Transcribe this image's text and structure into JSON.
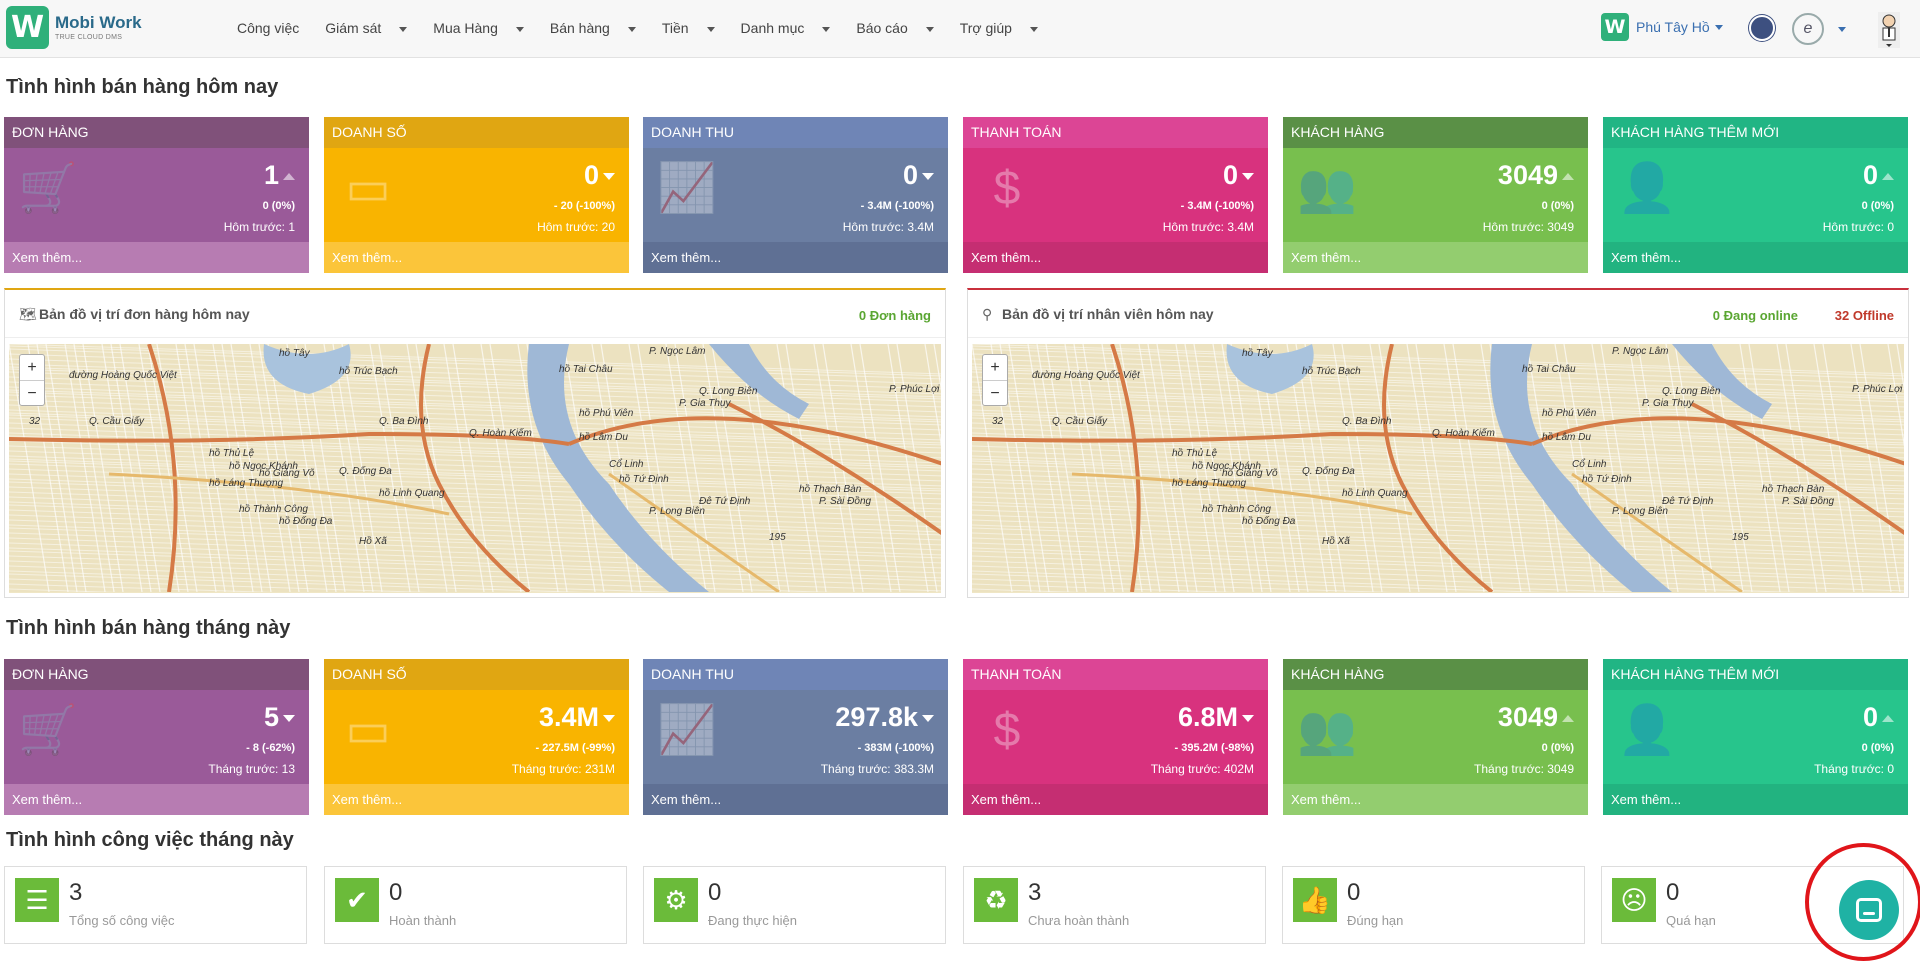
{
  "app": {
    "logo_mark": "W",
    "logo_name": "Mobi Work",
    "logo_tag": "TRUE CLOUD DMS"
  },
  "menu": [
    {
      "label": "Công việc",
      "dropdown": false
    },
    {
      "label": "Giám sát",
      "dropdown": true
    },
    {
      "label": "Mua Hàng",
      "dropdown": true
    },
    {
      "label": "Bán hàng",
      "dropdown": true
    },
    {
      "label": "Tiền",
      "dropdown": true
    },
    {
      "label": "Danh mục",
      "dropdown": true
    },
    {
      "label": "Báo cáo",
      "dropdown": true
    },
    {
      "label": "Trợ giúp",
      "dropdown": true
    }
  ],
  "header": {
    "branch": "Phú Tây Hồ",
    "branch_mark": "W"
  },
  "today": {
    "title": "Tình hình bán hàng hôm nay",
    "cards": [
      {
        "title": "ĐƠN HÀNG",
        "value": "1",
        "change": "0 (0%)",
        "prev": "Hôm trước: 1",
        "more": "Xem thêm...",
        "icon": "cart-icon",
        "glyph": "🛒",
        "trend": "up"
      },
      {
        "title": "DOANH SỐ",
        "value": "0",
        "change": "- 20 (-100%)",
        "prev": "Hôm trước: 20",
        "more": "Xem thêm...",
        "icon": "credit-card-icon",
        "glyph": "▭",
        "trend": "down"
      },
      {
        "title": "DOANH THU",
        "value": "0",
        "change": "- 3.4M (-100%)",
        "prev": "Hôm trước: 3.4M",
        "more": "Xem thêm...",
        "icon": "line-chart-icon",
        "glyph": "📈",
        "trend": "down"
      },
      {
        "title": "THANH TOÁN",
        "value": "0",
        "change": "- 3.4M (-100%)",
        "prev": "Hôm trước: 3.4M",
        "more": "Xem thêm...",
        "icon": "dollar-icon",
        "glyph": "$",
        "trend": "down"
      },
      {
        "title": "KHÁCH HÀNG",
        "value": "3049",
        "change": "0 (0%)",
        "prev": "Hôm trước: 3049",
        "more": "Xem thêm...",
        "icon": "users-icon",
        "glyph": "👥",
        "trend": "up"
      },
      {
        "title": "KHÁCH HÀNG THÊM MỚI",
        "value": "0",
        "change": "0 (0%)",
        "prev": "Hôm trước: 0",
        "more": "Xem thêm...",
        "icon": "user-plus-icon",
        "glyph": "👤",
        "trend": "up"
      }
    ]
  },
  "maps": {
    "orders": {
      "title": "Bản đồ vị trí đơn hàng hôm nay",
      "count": "0 Đơn hàng",
      "count_color": "#5aa632"
    },
    "staff": {
      "title": "Bản đồ vị trí nhân viên hôm nay",
      "online": "0 Đang online",
      "offline": "32 Offline",
      "online_color": "#5aa632",
      "offline_color": "#c0392b"
    },
    "zoom_in": "+",
    "zoom_out": "−",
    "labels": [
      "hồ Tây",
      "đường Hoàng Quốc Việt",
      "hồ Trúc Bạch",
      "Q. Cầu Giấy",
      "Q. Ba Đình",
      "Q. Hoàn Kiếm",
      "Q. Long Biên",
      "Q. Đống Đa",
      "hồ Linh Quang",
      "hồ Thủ Lệ",
      "hồ Ngọc Khánh",
      "hồ Giảng Võ",
      "hồ Láng Thượng",
      "hồ Thành Công",
      "hồ Đống Đa",
      "hồ Phú Viên",
      "hồ Lâm Du",
      "P. Phúc Lợi",
      "P. Gia Thụy",
      "Cổ Linh",
      "hồ Tứ Định",
      "hồ Thạch Bàn",
      "P. Sài Đồng",
      "P. Long Biên",
      "Đê Tứ Định",
      "P. Ngọc Lâm",
      "hồ Tai Châu",
      "Hồ Xã",
      "32",
      "195"
    ]
  },
  "month": {
    "title": "Tình hình bán hàng tháng này",
    "cards": [
      {
        "title": "ĐƠN HÀNG",
        "value": "5",
        "change": "- 8 (-62%)",
        "prev": "Tháng trước: 13",
        "more": "Xem thêm...",
        "icon": "cart-icon",
        "glyph": "🛒",
        "trend": "down"
      },
      {
        "title": "DOANH SỐ",
        "value": "3.4M",
        "change": "- 227.5M (-99%)",
        "prev": "Tháng trước: 231M",
        "more": "Xem thêm...",
        "icon": "credit-card-icon",
        "glyph": "▭",
        "trend": "down"
      },
      {
        "title": "DOANH THU",
        "value": "297.8k",
        "change": "- 383M (-100%)",
        "prev": "Tháng trước: 383.3M",
        "more": "Xem thêm...",
        "icon": "line-chart-icon",
        "glyph": "📈",
        "trend": "down"
      },
      {
        "title": "THANH TOÁN",
        "value": "6.8M",
        "change": "- 395.2M (-98%)",
        "prev": "Tháng trước: 402M",
        "more": "Xem thêm...",
        "icon": "dollar-icon",
        "glyph": "$",
        "trend": "down"
      },
      {
        "title": "KHÁCH HÀNG",
        "value": "3049",
        "change": "0 (0%)",
        "prev": "Tháng trước: 3049",
        "more": "Xem thêm...",
        "icon": "users-icon",
        "glyph": "👥",
        "trend": "up"
      },
      {
        "title": "KHÁCH HÀNG THÊM MỚI",
        "value": "0",
        "change": "0 (0%)",
        "prev": "Tháng trước: 0",
        "more": "Xem thêm...",
        "icon": "user-plus-icon",
        "glyph": "👤",
        "trend": "up"
      }
    ]
  },
  "tasks": {
    "title": "Tình hình công việc tháng này",
    "items": [
      {
        "value": "3",
        "label": "Tổng số công việc",
        "icon": "list-icon",
        "glyph": "☰"
      },
      {
        "value": "0",
        "label": "Hoàn thành",
        "icon": "calendar-check-icon",
        "glyph": "✔"
      },
      {
        "value": "0",
        "label": "Đang thực hiện",
        "icon": "gears-icon",
        "glyph": "⚙"
      },
      {
        "value": "3",
        "label": "Chưa hoàn thành",
        "icon": "recycle-icon",
        "glyph": "♻"
      },
      {
        "value": "0",
        "label": "Đúng hạn",
        "icon": "thumbs-up-icon",
        "glyph": "👍"
      },
      {
        "value": "0",
        "label": "Quá hạn",
        "icon": "frown-icon",
        "glyph": "☹"
      }
    ]
  }
}
